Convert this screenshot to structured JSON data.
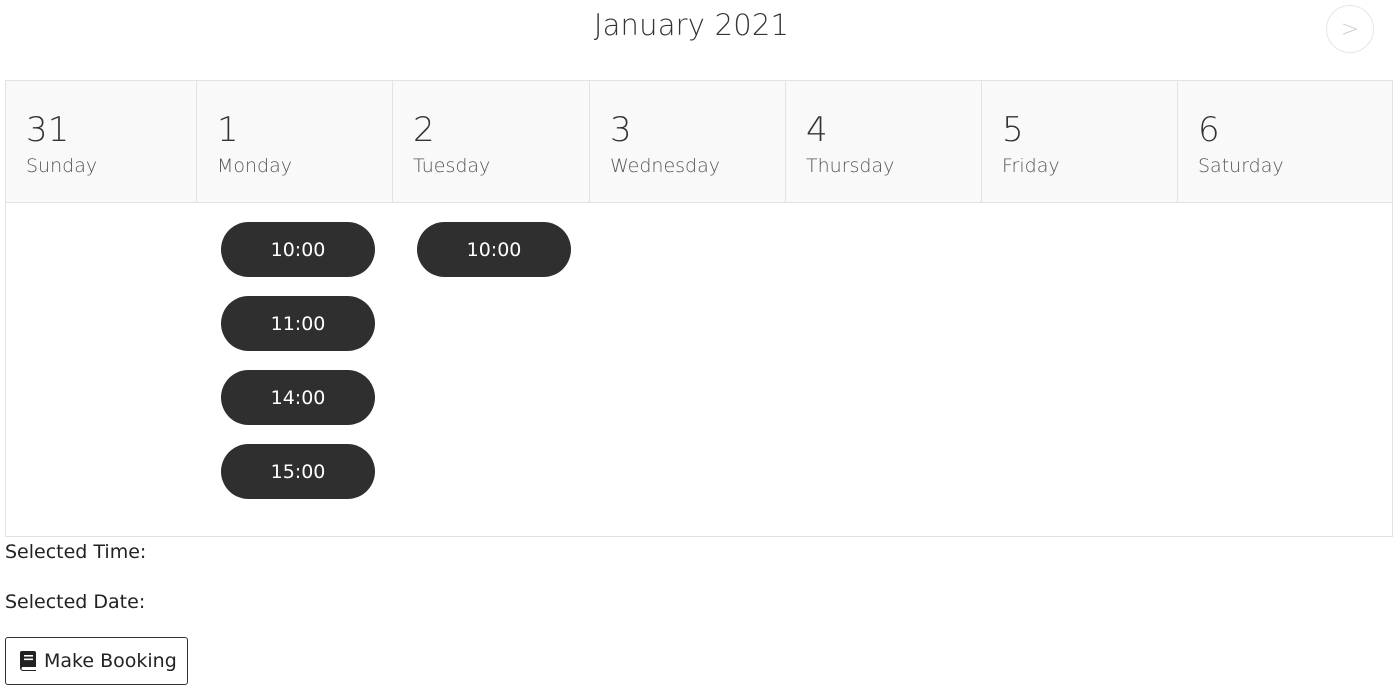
{
  "header": {
    "month_title": "January 2021",
    "next_label": ">"
  },
  "days": [
    {
      "num": "31",
      "name": "Sunday",
      "slots": []
    },
    {
      "num": "1",
      "name": "Monday",
      "slots": [
        "10:00",
        "11:00",
        "14:00",
        "15:00"
      ]
    },
    {
      "num": "2",
      "name": "Tuesday",
      "slots": [
        "10:00"
      ]
    },
    {
      "num": "3",
      "name": "Wednesday",
      "slots": []
    },
    {
      "num": "4",
      "name": "Thursday",
      "slots": []
    },
    {
      "num": "5",
      "name": "Friday",
      "slots": []
    },
    {
      "num": "6",
      "name": "Saturday",
      "slots": []
    }
  ],
  "selection": {
    "time_label": "Selected Time:",
    "date_label": "Selected Date:"
  },
  "booking": {
    "button_label": "Make Booking",
    "icon": "book-icon"
  },
  "colors": {
    "slot_bg": "#2f2f2f",
    "header_bg": "#f9f9f9",
    "border": "#e2e2e2"
  }
}
